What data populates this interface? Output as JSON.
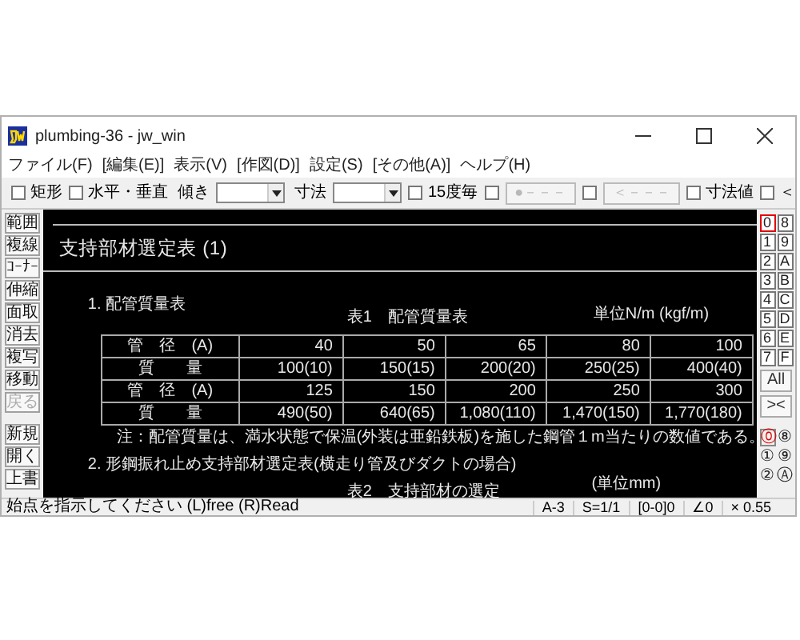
{
  "window": {
    "title": "plumbing-36 - jw_win"
  },
  "menu": [
    "ファイル(F)",
    "[編集(E)]",
    "表示(V)",
    "[作図(D)]",
    "設定(S)",
    "[その他(A)]",
    "ヘルプ(H)"
  ],
  "toolbar": [
    {
      "kind": "checkbox",
      "label": "矩形",
      "checked": false
    },
    {
      "kind": "checkbox",
      "label": "水平・垂直",
      "checked": false
    },
    {
      "kind": "combo",
      "label": "傾き"
    },
    {
      "kind": "combo",
      "label": "寸法"
    },
    {
      "kind": "checkbox",
      "label": "15度毎",
      "checked": false
    },
    {
      "kind": "checkbox",
      "checked": false
    },
    {
      "kind": "button",
      "label": "●－－－",
      "disabled": true
    },
    {
      "kind": "checkbox",
      "checked": false
    },
    {
      "kind": "button",
      "label": "＜－－－",
      "disabled": true
    },
    {
      "kind": "checkbox",
      "label": "寸法値",
      "checked": false
    },
    {
      "kind": "checkbox",
      "label": "＜",
      "checked": false
    }
  ],
  "left_tools": [
    [
      {
        "label": "範囲",
        "disabled": false
      },
      {
        "label": "複線",
        "disabled": false
      },
      {
        "label": "ｺｰﾅｰ",
        "disabled": false
      },
      {
        "label": "伸縮",
        "disabled": false
      },
      {
        "label": "面取",
        "disabled": false
      },
      {
        "label": "消去",
        "disabled": false
      },
      {
        "label": "複写",
        "disabled": false
      },
      {
        "label": "移動",
        "disabled": false
      },
      {
        "label": "戻る",
        "disabled": true
      }
    ],
    [
      {
        "label": "新規",
        "disabled": false
      },
      {
        "label": "開く",
        "disabled": false
      },
      {
        "label": "上書",
        "disabled": false
      }
    ]
  ],
  "drawing": {
    "title": "支持部材選定表 (1)",
    "section_1": "1. 配管質量表",
    "table_1_caption": "表1　配管質量表",
    "table_1_unit": "単位N/m (kgf/m)",
    "table_1": [
      [
        "管　径　(A)",
        "40",
        "50",
        "65",
        "80",
        "100"
      ],
      [
        "質　　量",
        "100(10)",
        "150(15)",
        "200(20)",
        "250(25)",
        "400(40)"
      ],
      [
        "管　径　(A)",
        "125",
        "150",
        "200",
        "250",
        "300"
      ],
      [
        "質　　量",
        "490(50)",
        "640(65)",
        "1,080(110)",
        "1,470(150)",
        "1,770(180)"
      ]
    ],
    "note": "注：配管質量は、満水状態で保温(外装は亜鉛鉄板)を施した鋼管１m当たりの数値である。",
    "section_2": "2. 形鋼振れ止め支持部材選定表(横走り管及びダクトの場合)",
    "table_2_caption": "表2　支持部材の選定",
    "table_2_unit": "(単位mm)"
  },
  "layers": [
    {
      "label": "0",
      "selected": true
    },
    {
      "label": "8",
      "selected": false
    },
    {
      "label": "1",
      "selected": false
    },
    {
      "label": "9",
      "selected": false
    },
    {
      "label": "2",
      "selected": false
    },
    {
      "label": "A",
      "selected": false
    },
    {
      "label": "3",
      "selected": false
    },
    {
      "label": "B",
      "selected": false
    },
    {
      "label": "4",
      "selected": false
    },
    {
      "label": "C",
      "selected": false
    },
    {
      "label": "5",
      "selected": false
    },
    {
      "label": "D",
      "selected": false
    },
    {
      "label": "6",
      "selected": false
    },
    {
      "label": "E",
      "selected": false
    },
    {
      "label": "7",
      "selected": false
    },
    {
      "label": "F",
      "selected": false
    }
  ],
  "layer_actions": [
    "All",
    "><"
  ],
  "layer_groups": [
    {
      "label": "⓪",
      "selected": true
    },
    {
      "label": "⑧",
      "selected": false
    },
    {
      "label": "①",
      "selected": false
    },
    {
      "label": "⑨",
      "selected": false
    },
    {
      "label": "②",
      "selected": false
    },
    {
      "label": "Ⓐ",
      "selected": false
    }
  ],
  "status": {
    "message": "始点を指示してください (L)free (R)Read",
    "fields": [
      "A-3",
      "S=1/1",
      "[0-0]0",
      "∠0",
      "× 0.55"
    ]
  }
}
